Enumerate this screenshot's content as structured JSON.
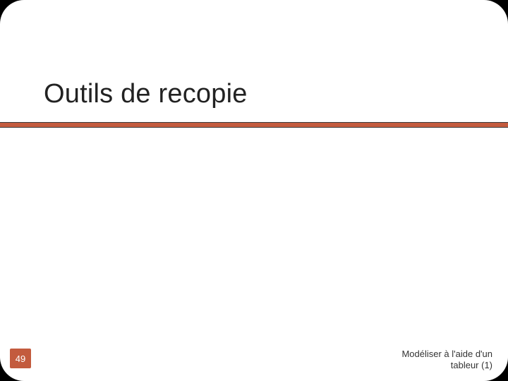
{
  "slide": {
    "title": "Outils de recopie",
    "page_number": "49",
    "footer": "Modéliser à l'aide d'un tableur (1)"
  }
}
